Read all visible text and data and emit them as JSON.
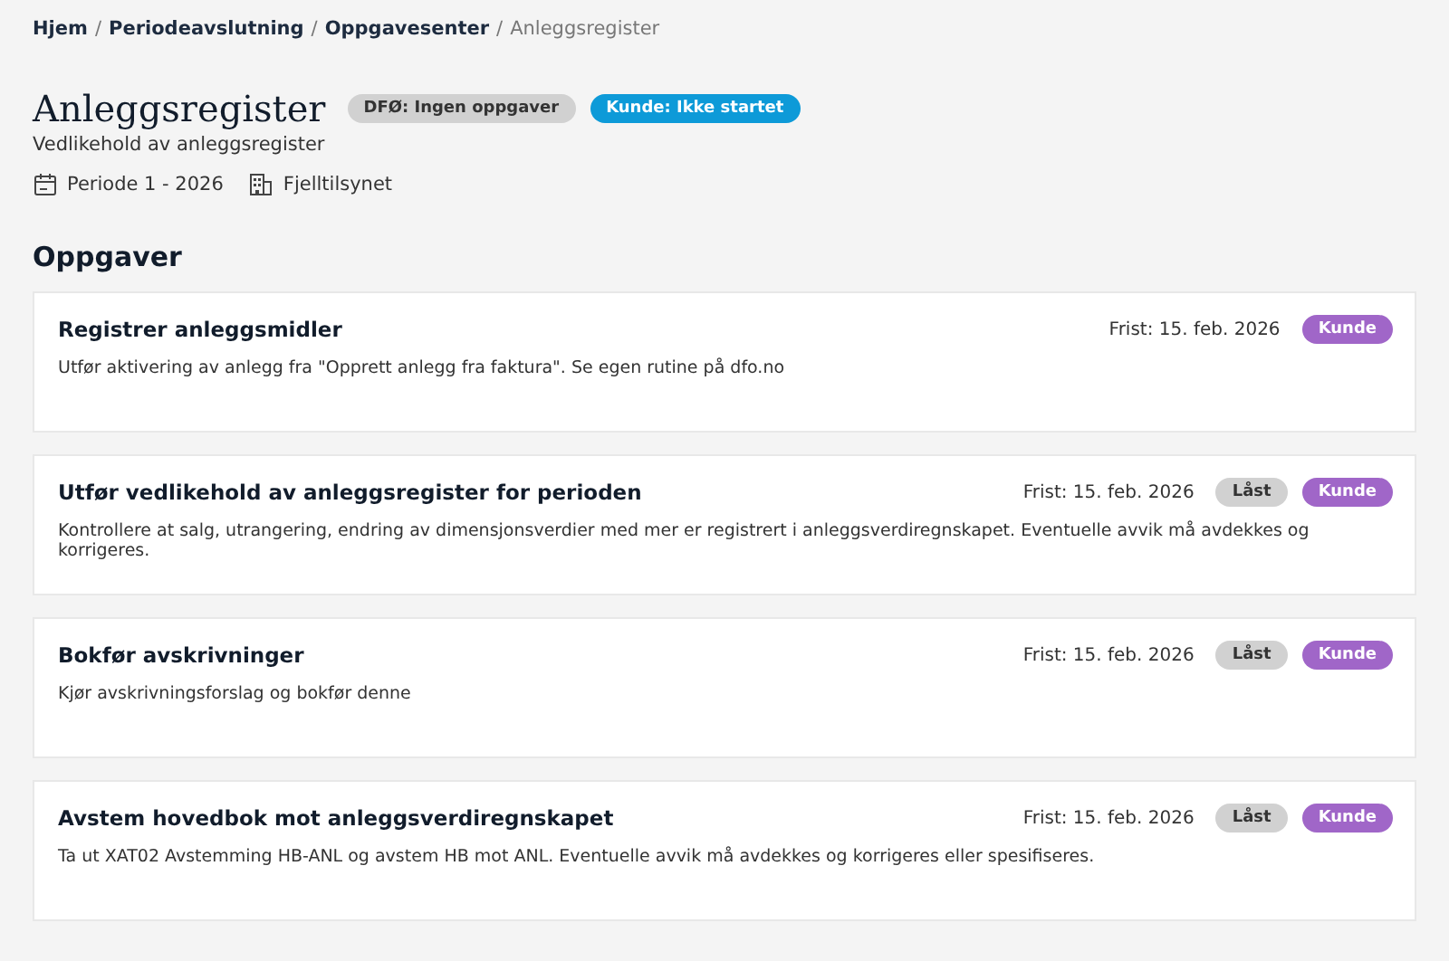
{
  "breadcrumb": [
    {
      "label": "Hjem",
      "current": false
    },
    {
      "label": "Periodeavslutning",
      "current": false
    },
    {
      "label": "Oppgavesenter",
      "current": false
    },
    {
      "label": "Anleggsregister",
      "current": true
    }
  ],
  "breadcrumb_separator": "/",
  "page": {
    "title": "Anleggsregister",
    "subtitle": "Vedlikehold av anleggsregister",
    "badges": [
      {
        "label": "DFØ: Ingen oppgaver",
        "color": "#d1d1d1",
        "kind": "light"
      },
      {
        "label": "Kunde: Ikke startet",
        "color": "#0d9ad8",
        "kind": "dark"
      }
    ],
    "period": "Periode 1 - 2026",
    "organization": "Fjelltilsynet"
  },
  "section_title": "Oppgaver",
  "tasks": [
    {
      "title": "Registrer anleggsmidler",
      "description": "Utfør aktivering av anlegg fra \"Opprett anlegg fra faktura\". Se egen rutine på dfo.no",
      "deadline": "Frist: 15. feb. 2026",
      "badges": [
        {
          "label": "Kunde",
          "color": "#a066c8",
          "kind": "dark"
        }
      ]
    },
    {
      "title": "Utfør vedlikehold av anleggsregister for perioden",
      "description": "Kontrollere at salg, utrangering, endring av dimensjonsverdier med mer er registrert i anleggsverdiregnskapet. Eventuelle avvik må avdekkes og korrigeres.",
      "deadline": "Frist: 15. feb. 2026",
      "badges": [
        {
          "label": "Låst",
          "color": "#d1d1d1",
          "kind": "light"
        },
        {
          "label": "Kunde",
          "color": "#a066c8",
          "kind": "dark"
        }
      ]
    },
    {
      "title": "Bokfør avskrivninger",
      "description": "Kjør avskrivningsforslag og bokfør denne",
      "deadline": "Frist: 15. feb. 2026",
      "badges": [
        {
          "label": "Låst",
          "color": "#d1d1d1",
          "kind": "light"
        },
        {
          "label": "Kunde",
          "color": "#a066c8",
          "kind": "dark"
        }
      ]
    },
    {
      "title": "Avstem hovedbok mot anleggsverdiregnskapet",
      "description": "Ta ut XAT02 Avstemming HB-ANL og avstem HB mot ANL. Eventuelle avvik må avdekkes og korrigeres eller spesifiseres.",
      "deadline": "Frist: 15. feb. 2026",
      "badges": [
        {
          "label": "Låst",
          "color": "#d1d1d1",
          "kind": "light"
        },
        {
          "label": "Kunde",
          "color": "#a066c8",
          "kind": "dark"
        }
      ]
    }
  ]
}
